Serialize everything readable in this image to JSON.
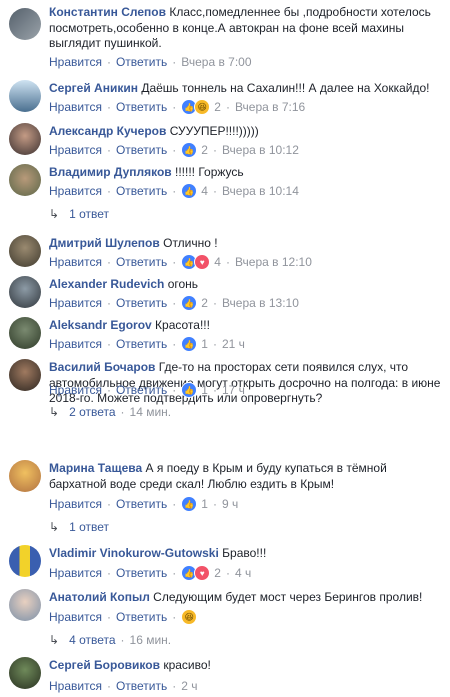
{
  "ui": {
    "like": "Нравится",
    "reply": "Ответить",
    "dot": "·"
  },
  "comments": [
    {
      "name": "Константин Слепов",
      "text": "Класс,помедленнее бы ,подробности хотелось посмотреть,особенно в конце.А автокран на фоне всей махины выглядит пушинкой.",
      "time": "Вчера в 7:00",
      "reacts": 0,
      "reaction_icons": []
    },
    {
      "name": "Сергей Аникин",
      "text": "Даёшь тоннель на Сахалин!!! А далее на Хоккайдо!",
      "time": "Вчера в 7:16",
      "reacts": "2",
      "reaction_icons": [
        "like-icon",
        "haha-icon"
      ]
    },
    {
      "name": "Александр Кучеров",
      "text": "СУУУПЕР!!!!)))))",
      "time": "Вчера в 10:12",
      "reacts": "2",
      "reaction_icons": [
        "like-icon"
      ]
    },
    {
      "name": "Владимир Дупляков",
      "text": "!!!!!! Горжусь",
      "time": "Вчера в 10:14",
      "reacts": "4",
      "reaction_icons": [
        "like-icon"
      ],
      "replies": "1 ответ"
    },
    {
      "name": "Дмитрий Шулепов",
      "text": "Отлично !",
      "time": "Вчера в 12:10",
      "reacts": "4",
      "reaction_icons": [
        "like-icon",
        "love-icon"
      ]
    },
    {
      "name": "Alexander Rudevich",
      "text": "огонь",
      "time": "Вчера в 13:10",
      "reacts": "2",
      "reaction_icons": [
        "like-icon"
      ]
    },
    {
      "name": "Aleksandr Egorov",
      "text": "Красота!!!",
      "time": "21 ч",
      "reacts": "1",
      "reaction_icons": [
        "like-icon"
      ]
    },
    {
      "name": "Василий Бочаров",
      "text": "Где-то на просторах сети появился слух, что автомобильное движение могут открыть досрочно на полгода: в июне 2018-го. Можете подтвердить или опровергнуть?",
      "time": "17 ч",
      "reacts": "1",
      "reaction_icons": [
        "like-icon"
      ],
      "replies": "2 ответа",
      "replies_time": "14 мин."
    },
    {
      "name": "Марина Тащева",
      "text": "А я поеду в Крым и буду купаться в тёмной бархатной воде среди скал! Люблю ездить в Крым!",
      "time": "9 ч",
      "reacts": "1",
      "reaction_icons": [
        "like-icon"
      ],
      "replies": "1 ответ"
    },
    {
      "name": "Vladimir Vinokurow-Gutowski",
      "text": "Браво!!!",
      "time": "4 ч",
      "reacts": "2",
      "reaction_icons": [
        "like-icon",
        "love-icon"
      ]
    },
    {
      "name": "Анатолий Копыл",
      "text": "Следующим будет мост через Берингов пролив!",
      "time": "",
      "reacts": "",
      "reaction_icons": [
        "haha-icon"
      ],
      "replies": "4 ответа",
      "replies_time": "16 мин."
    },
    {
      "name": "Сергей Боровиков",
      "text": "красиво!",
      "time": "2 ч",
      "reacts": 0,
      "reaction_icons": []
    }
  ]
}
